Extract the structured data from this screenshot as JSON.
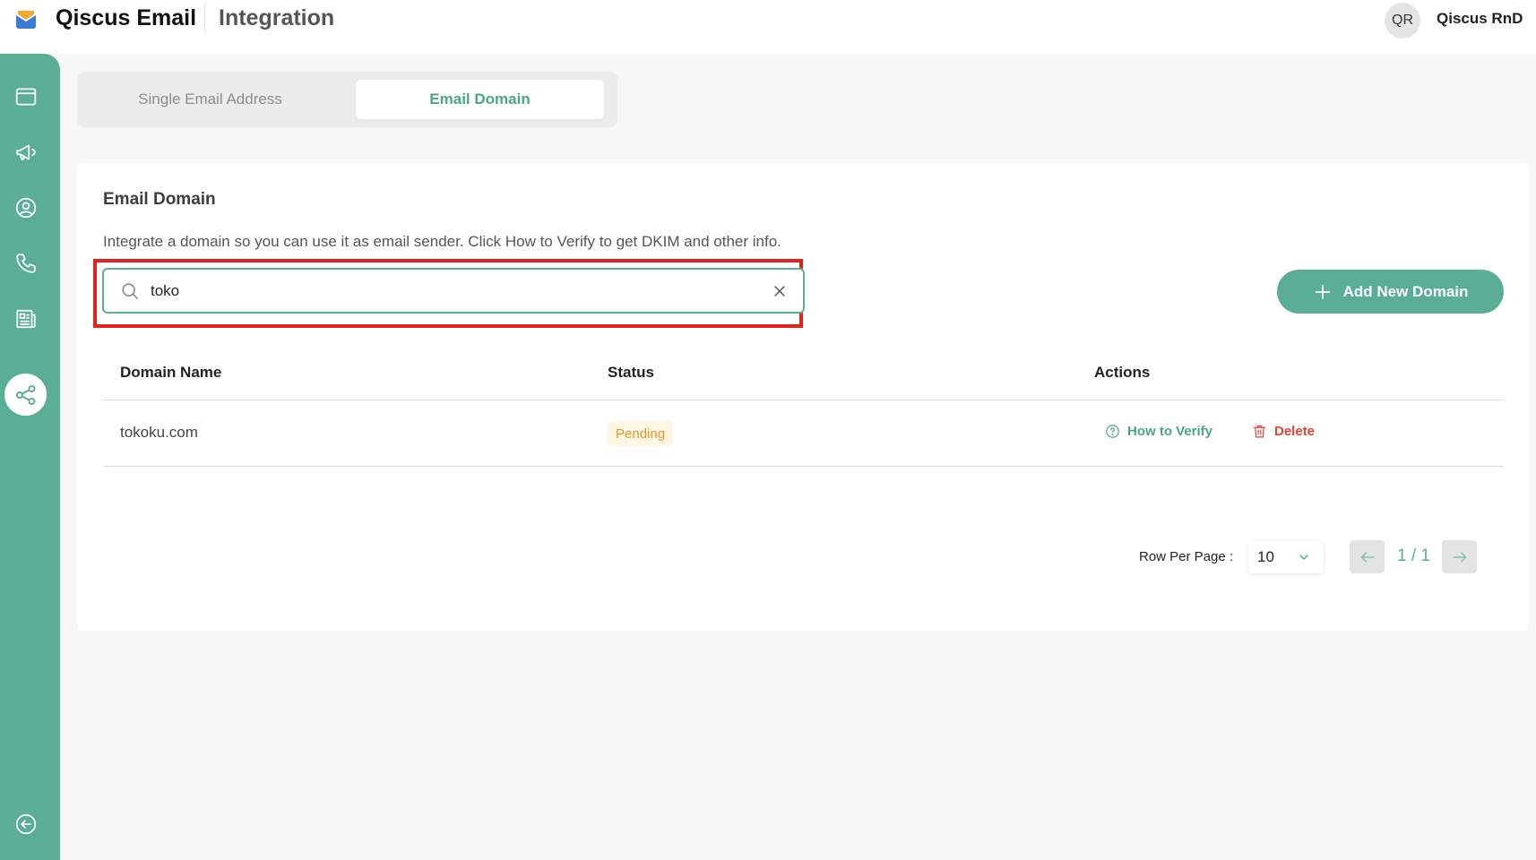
{
  "header": {
    "app_name": "Qiscus Email",
    "page_title": "Integration",
    "user": {
      "initials": "QR",
      "name": "Qiscus RnD"
    }
  },
  "sidebar": {
    "items": [
      {
        "icon": "window-icon",
        "active": false
      },
      {
        "icon": "megaphone-icon",
        "active": false
      },
      {
        "icon": "user-circle-icon",
        "active": false
      },
      {
        "icon": "phone-icon",
        "active": false
      },
      {
        "icon": "newspaper-icon",
        "active": false
      },
      {
        "icon": "share-nodes-icon",
        "active": true
      }
    ],
    "collapse_icon": "arrow-left-circle-icon"
  },
  "tabs": [
    {
      "label": "Single Email Address",
      "active": false
    },
    {
      "label": "Email Domain",
      "active": true
    }
  ],
  "card": {
    "title": "Email Domain",
    "description": "Integrate a domain so you can use it as email sender. Click How to Verify to get DKIM and other info.",
    "search": {
      "value": "toko",
      "placeholder": ""
    },
    "add_button_label": "Add New Domain"
  },
  "table": {
    "columns": [
      "Domain Name",
      "Status",
      "Actions"
    ],
    "rows": [
      {
        "domain": "tokoku.com",
        "status": "Pending",
        "actions": {
          "verify": "How to Verify",
          "delete": "Delete"
        }
      }
    ]
  },
  "pagination": {
    "rows_per_page_label": "Row Per Page :",
    "rows_per_page": "10",
    "page_info": "1 / 1"
  },
  "colors": {
    "primary": "#5bae96",
    "highlight_border": "#e0241b",
    "pending_text": "#e3962c",
    "pending_bg": "#fff6e4",
    "danger": "#e0413b"
  }
}
